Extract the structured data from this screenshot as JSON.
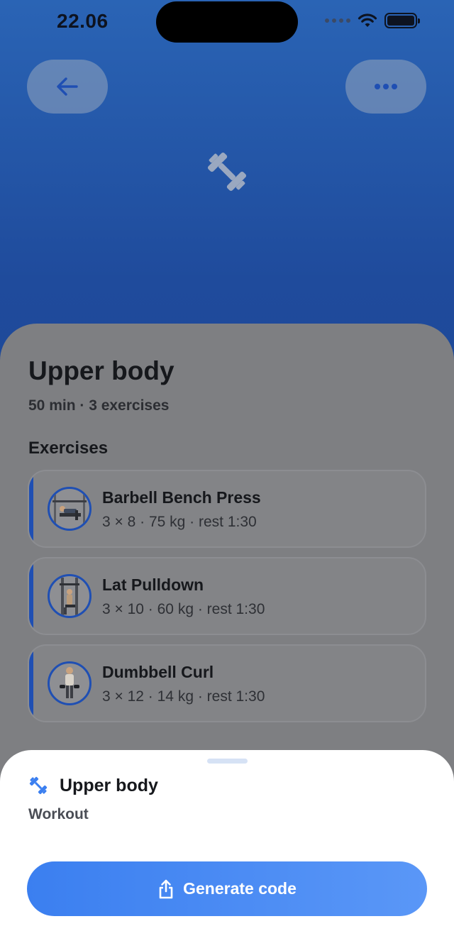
{
  "status_bar": {
    "time": "22.06"
  },
  "icons": {
    "back": "arrow-left-icon",
    "more": "ellipsis-icon",
    "hero": "dumbbell-icon",
    "share": "share-icon"
  },
  "colors": {
    "accent": "#1f4fb3",
    "button_gradient_start": "#3b7ff0",
    "button_gradient_end": "#5a97f7"
  },
  "workout": {
    "title": "Upper body",
    "meta": "50 min · 3 exercises"
  },
  "exercises_section": {
    "title": "Exercises",
    "items": [
      {
        "name": "Barbell Bench Press",
        "detail": "3 × 8 · 75 kg · rest 1:30"
      },
      {
        "name": "Lat Pulldown",
        "detail": "3 × 10 · 60 kg · rest 1:30"
      },
      {
        "name": "Dumbbell Curl",
        "detail": "3 × 12 · 14 kg · rest 1:30"
      }
    ]
  },
  "sheet": {
    "title": "Upper body",
    "subtitle": "Workout",
    "button_label": "Generate code"
  }
}
